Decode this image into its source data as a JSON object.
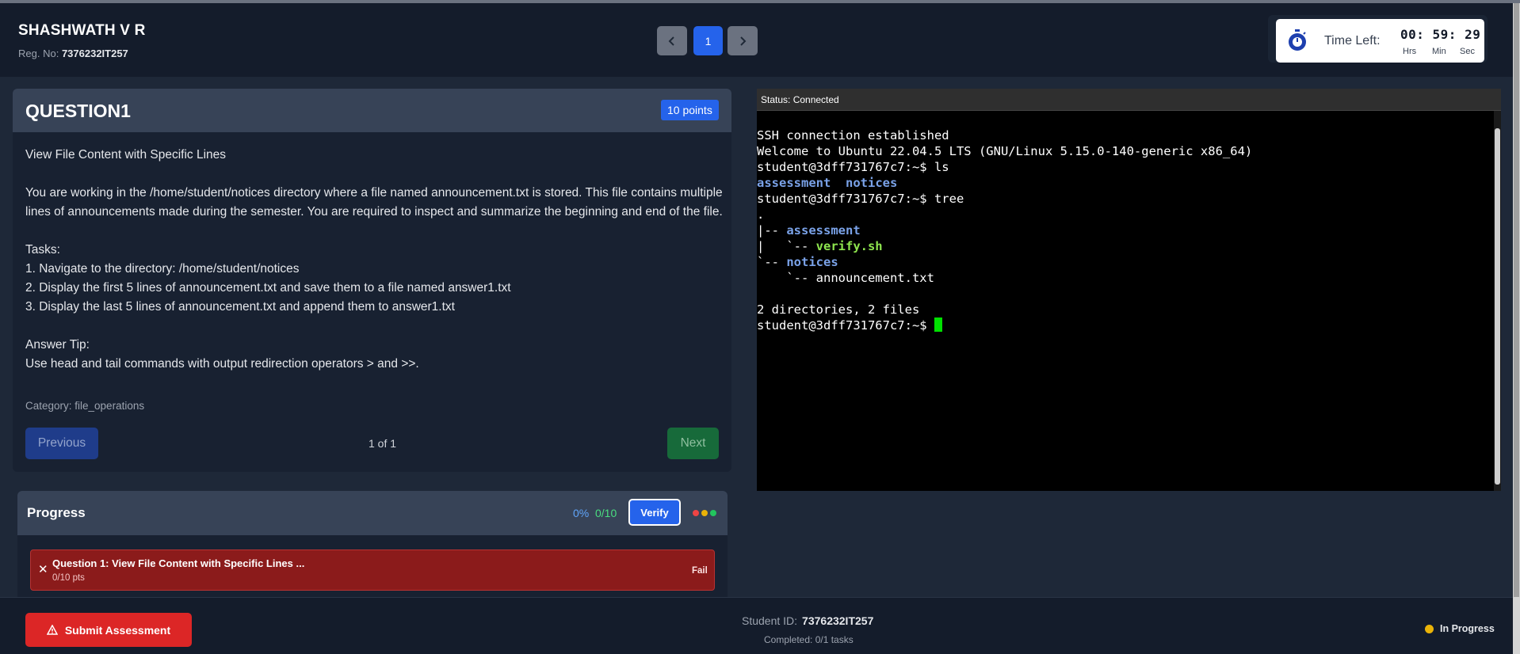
{
  "header": {
    "student_name": "SHASHWATH V R",
    "reg_label": "Reg. No:",
    "reg_number": "7376232IT257",
    "current_page": "1",
    "timer": {
      "label": "Time Left:",
      "value": "00: 59: 29",
      "units": [
        "Hrs",
        "Min",
        "Sec"
      ]
    }
  },
  "question": {
    "title": "QUESTION1",
    "points": "10 points",
    "lines": [
      "View File Content with Specific Lines",
      "",
      "You are working in the /home/student/notices directory where a file named announcement.txt is stored. This file contains multiple lines of announcements made during the semester. You are required to inspect and summarize the beginning and end of the file.",
      "",
      "Tasks:",
      "1. Navigate to the directory: /home/student/notices",
      "2. Display the first 5 lines of announcement.txt and save them to a file named answer1.txt",
      "3. Display the last 5 lines of announcement.txt and append them to answer1.txt",
      "",
      "Answer Tip:",
      "Use head and tail commands with output redirection operators > and >>."
    ],
    "category": "Category: file_operations",
    "previous_label": "Previous",
    "pager": "1 of 1",
    "next_label": "Next"
  },
  "progress": {
    "title": "Progress",
    "percent": "0%",
    "score": "0/10",
    "verify_label": "Verify",
    "dots": [
      "#ef4444",
      "#eab308",
      "#22c55e"
    ],
    "tasks": [
      {
        "title": "Question 1: View File Content with Specific Lines ...",
        "points": "0/10 pts",
        "status": "Fail"
      }
    ]
  },
  "terminal": {
    "status": "Status: Connected",
    "lines": [
      [
        {
          "t": "SSH connection established"
        }
      ],
      [
        {
          "t": "Welcome to Ubuntu 22.04.5 LTS (GNU/Linux 5.15.0-140-generic x86_64)"
        }
      ],
      [
        {
          "t": "student@3dff731767c7:~$ ls"
        }
      ],
      [
        {
          "t": "assessment",
          "c": "blue"
        },
        {
          "t": "  "
        },
        {
          "t": "notices",
          "c": "blue"
        }
      ],
      [
        {
          "t": "student@3dff731767c7:~$ tree"
        }
      ],
      [
        {
          "t": "."
        }
      ],
      [
        {
          "t": "|-- "
        },
        {
          "t": "assessment",
          "c": "blue"
        }
      ],
      [
        {
          "t": "|   `-- "
        },
        {
          "t": "verify.sh",
          "c": "green"
        }
      ],
      [
        {
          "t": "`-- "
        },
        {
          "t": "notices",
          "c": "blue"
        }
      ],
      [
        {
          "t": "    `-- announcement.txt"
        }
      ],
      [
        {
          "t": ""
        }
      ],
      [
        {
          "t": "2 directories, 2 files"
        }
      ],
      [
        {
          "t": "student@3dff731767c7:~$ "
        },
        {
          "cursor": true
        }
      ]
    ],
    "colors": {
      "blue": "#7aa2e8",
      "green": "#8ee54e",
      "cursor": "#00e000"
    }
  },
  "footer": {
    "submit_label": "Submit Assessment",
    "student_id_label": "Student ID:",
    "student_id": "7376232IT257",
    "completed": "Completed: 0/1 tasks",
    "status": "In Progress"
  },
  "colors": {
    "accent": "#2563eb",
    "danger": "#dc2626",
    "fail_row": "#8b1b1b",
    "in_progress": "#eab308"
  }
}
